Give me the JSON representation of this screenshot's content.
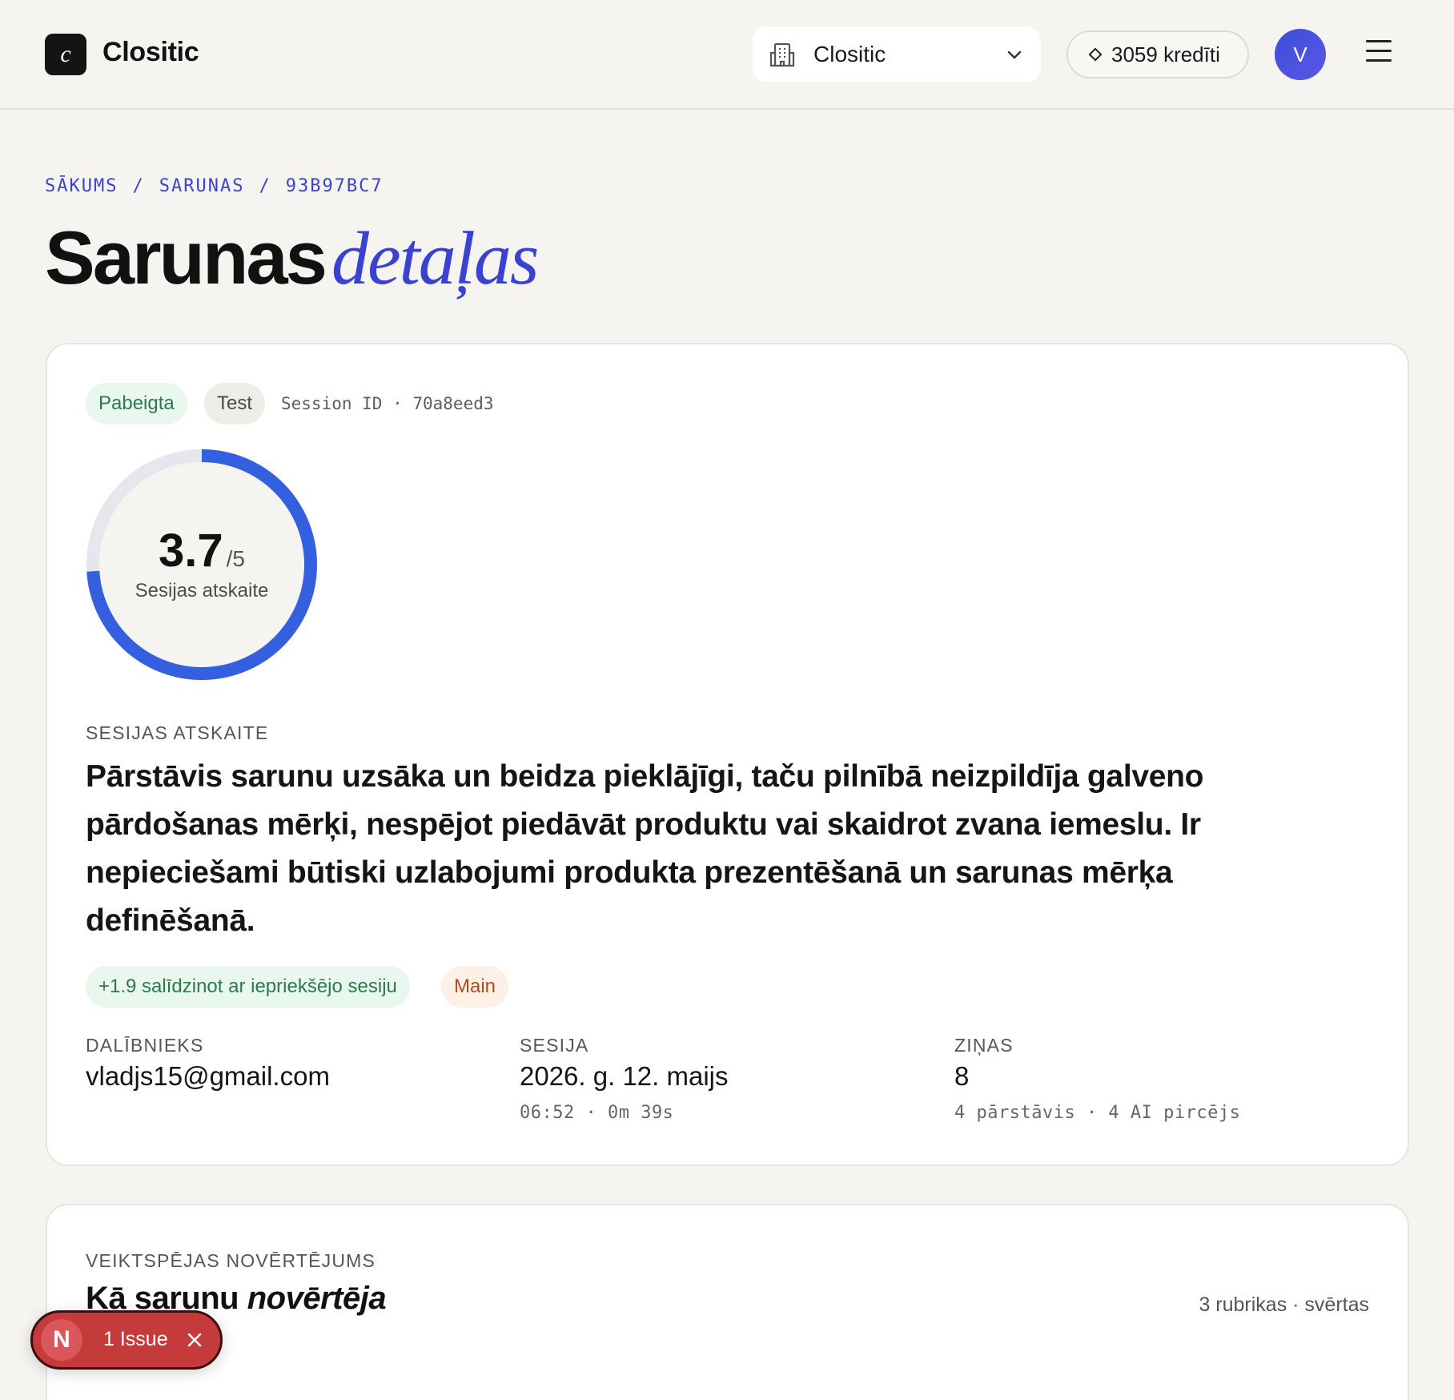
{
  "header": {
    "logo_letter": "c",
    "app_name": "Clositic",
    "org_select": {
      "value": "Clositic"
    },
    "credits": "3059 kredīti",
    "avatar_initial": "V"
  },
  "breadcrumb": [
    "SĀKUMS",
    "SARUNAS",
    "93B97BC7"
  ],
  "page_title": {
    "main": "Sarunas",
    "accent": "detaļas"
  },
  "session": {
    "status": "Pabeigta",
    "type": "Test",
    "session_id": "Session ID · 70a8eed3",
    "score": {
      "value": "3.7",
      "max": "/5",
      "caption": "Sesijas atskaite",
      "fraction": 0.74
    },
    "report_label": "SESIJAS ATSKAITE",
    "report_text": "Pārstāvis sarunu uzsāka un beidza pieklājīgi, taču pilnībā neizpildīja galveno pārdošanas mērķi, nespējot piedāvāt produktu vai skaidrot zvana iemeslu. Ir nepieciešami būtiski uzlabojumi produkta prezentēšanā un sarunas mērķa definēšanā.",
    "diff": "+1.9 salīdzinot ar iepriekšējo sesiju",
    "tag": "Main",
    "meta": {
      "participant": {
        "label": "DALĪBNIEKS",
        "value": "vladjs15@gmail.com"
      },
      "session": {
        "label": "SESIJA",
        "value": "2026. g. 12. maijs",
        "sub": "06:52 · 0m 39s"
      },
      "messages": {
        "label": "ZIŅAS",
        "value": "8",
        "sub": "4 pārstāvis · 4 AI pircējs"
      }
    }
  },
  "performance": {
    "label": "VEIKTSPĒJAS NOVĒRTĒJUMS",
    "title_main": "Kā sarunu",
    "title_accent": "novērtēja",
    "meta": "3 rubrikas · svērtas"
  },
  "issue_toast": {
    "letter": "N",
    "text": "1 Issue"
  },
  "colors": {
    "accent": "#3a43cf",
    "gauge": "#3460e0",
    "success": "#2c7a4b",
    "danger": "#c53a3a"
  }
}
